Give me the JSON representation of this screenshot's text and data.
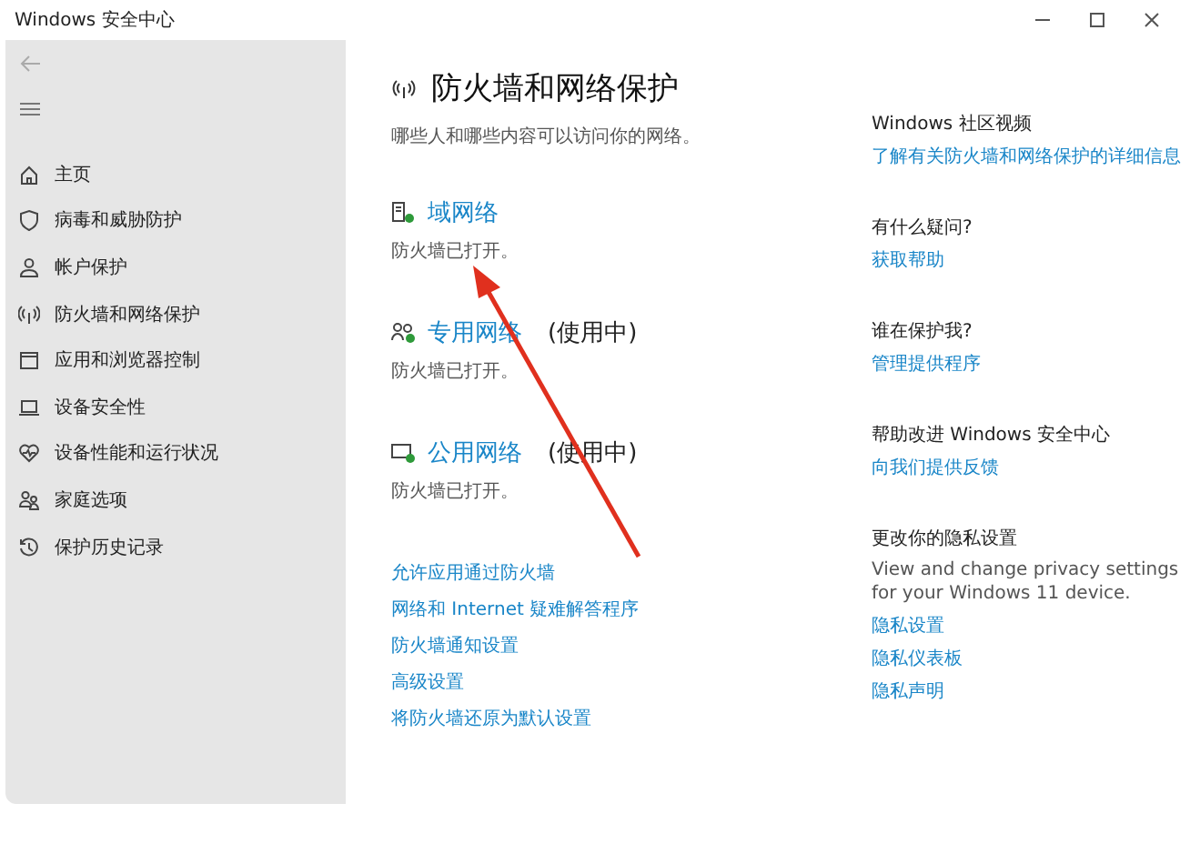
{
  "window": {
    "title": "Windows 安全中心"
  },
  "sidebar": {
    "items": [
      {
        "label": "主页",
        "kind": "home",
        "selected": false
      },
      {
        "label": "病毒和威胁防护",
        "kind": "shield",
        "selected": false
      },
      {
        "label": "帐户保护",
        "kind": "person",
        "selected": false
      },
      {
        "label": "防火墙和网络保护",
        "kind": "antenna",
        "selected": false
      },
      {
        "label": "应用和浏览器控制",
        "kind": "window",
        "selected": false
      },
      {
        "label": "设备安全性",
        "kind": "laptop",
        "selected": false
      },
      {
        "label": "设备性能和运行状况",
        "kind": "heart",
        "selected": false
      },
      {
        "label": "家庭选项",
        "kind": "family",
        "selected": false
      },
      {
        "label": "保护历史记录",
        "kind": "history",
        "selected": false
      }
    ]
  },
  "page": {
    "title": "防火墙和网络保护",
    "subtitle": "哪些人和哪些内容可以访问你的网络。",
    "networks": [
      {
        "kind": "domain",
        "name": "域网络",
        "status": "防火墙已打开。"
      },
      {
        "kind": "private",
        "name": "专用网络",
        "in_use": "(使用中)",
        "status": "防火墙已打开。"
      },
      {
        "kind": "public",
        "name": "公用网络",
        "in_use": "(使用中)",
        "status": "防火墙已打开。"
      }
    ],
    "links": [
      "允许应用通过防火墙",
      "网络和 Internet 疑难解答程序",
      "防火墙通知设置",
      "高级设置",
      "将防火墙还原为默认设置"
    ]
  },
  "aside": [
    {
      "heading": "Windows 社区视频",
      "links": [
        "了解有关防火墙和网络保护的详细信息"
      ]
    },
    {
      "heading": "有什么疑问?",
      "links": [
        "获取帮助"
      ]
    },
    {
      "heading": "谁在保护我?",
      "links": [
        "管理提供程序"
      ]
    },
    {
      "heading": "帮助改进 Windows 安全中心",
      "links": [
        "向我们提供反馈"
      ]
    },
    {
      "heading": "更改你的隐私设置",
      "text": "View and change privacy settings for your Windows 11 device.",
      "links": [
        "隐私设置",
        "隐私仪表板",
        "隐私声明"
      ]
    }
  ],
  "annotation": {
    "kind": "arrow"
  }
}
